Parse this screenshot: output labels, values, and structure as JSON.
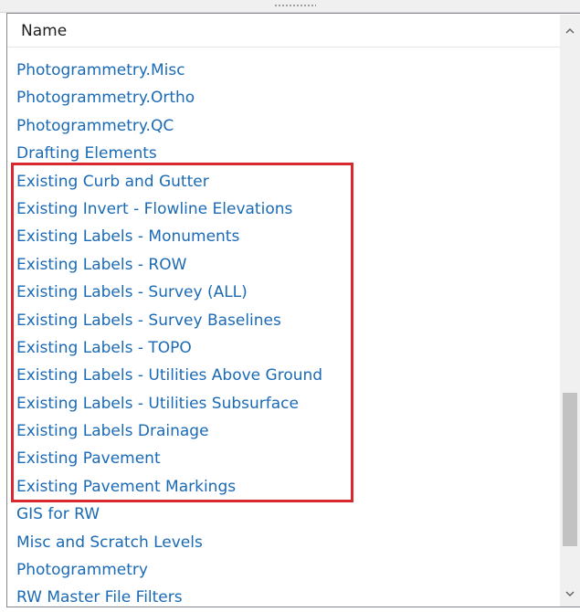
{
  "header": {
    "column_name": "Name"
  },
  "list": {
    "items": [
      "Photogrammetry.Misc",
      "Photogrammetry.Ortho",
      "Photogrammetry.QC",
      "Drafting Elements",
      "Existing Curb and Gutter",
      "Existing Invert - Flowline Elevations",
      "Existing Labels - Monuments",
      "Existing Labels - ROW",
      "Existing Labels - Survey (ALL)",
      "Existing Labels - Survey Baselines",
      "Existing Labels - TOPO",
      "Existing Labels - Utilities Above Ground",
      "Existing Labels - Utilities Subsurface",
      "Existing Labels Drainage",
      "Existing Pavement",
      "Existing Pavement Markings",
      "GIS for RW",
      "Misc and Scratch Levels",
      "Photogrammetry",
      "RW Master File Filters"
    ]
  },
  "scrollbar": {
    "up_icon": "chevron-up-icon",
    "down_icon": "chevron-down-icon"
  },
  "colors": {
    "item_text": "#1a6ab5",
    "highlight_border": "#d9282f",
    "header_text": "#1e1e1e"
  }
}
